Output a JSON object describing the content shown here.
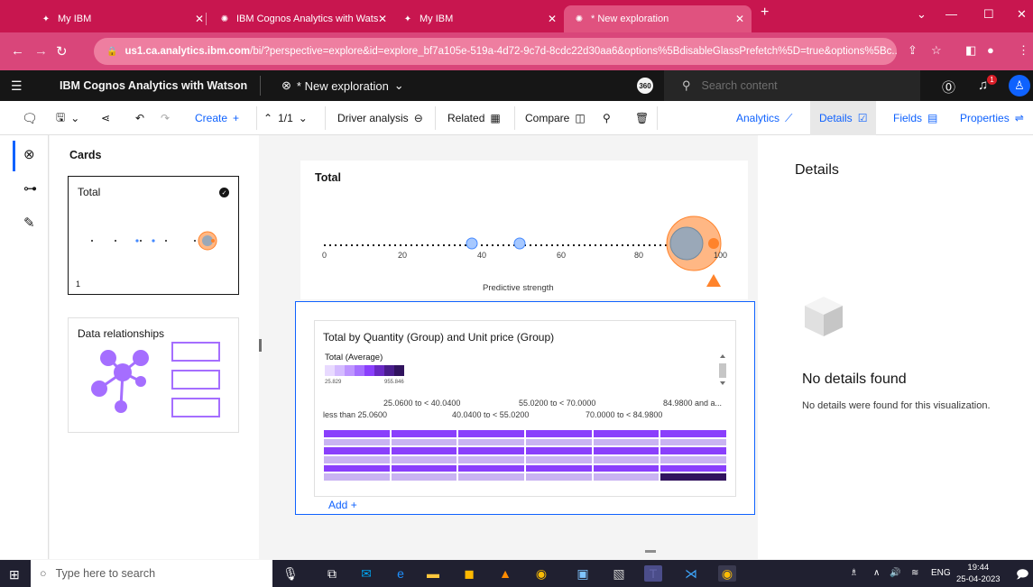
{
  "browser": {
    "tabs": [
      {
        "label": "My IBM",
        "active": false
      },
      {
        "label": "IBM Cognos Analytics with Wats",
        "active": false
      },
      {
        "label": "My IBM",
        "active": false
      },
      {
        "label": "* New exploration",
        "active": true
      }
    ],
    "new_tab": "+",
    "url_host": "us1.ca.analytics.ibm.com",
    "url_path": "/bi/?perspective=explore&id=explore_bf7a105e-519a-4d72-9c7d-8cdc22d30aa6&options%5BdisableGlassPrefetch%5D=true&options%5Bc..."
  },
  "app": {
    "product_name": "IBM Cognos Analytics with Watson",
    "exploration_title": "* New exploration",
    "badge": "360",
    "search_placeholder": "Search content",
    "notifications": "1"
  },
  "toolbar": {
    "create": "Create",
    "page_indicator": "1/1",
    "driver_analysis": "Driver analysis",
    "related": "Related",
    "compare": "Compare",
    "analytics": "Analytics",
    "details": "Details",
    "fields": "Fields",
    "properties": "Properties"
  },
  "cards_panel": {
    "title": "Cards",
    "card_total_label": "Total",
    "card_total_number": "1",
    "card_relationships_label": "Data relationships"
  },
  "total_card": {
    "title": "Total",
    "axis_label": "Predictive strength",
    "ticks": [
      "0",
      "20",
      "40",
      "60",
      "80",
      "100"
    ]
  },
  "viz": {
    "title": "Total by Quantity (Group) and Unit price (Group)",
    "legend_title": "Total (Average)",
    "legend_min": "25.829",
    "legend_max": "955.846",
    "categories_row1": [
      "25.0600 to < 40.0400",
      "55.0200 to < 70.0000",
      "84.9800 and a..."
    ],
    "categories_row2": [
      "less than 25.0600",
      "40.0400 to < 55.0200",
      "70.0000 to < 84.9800"
    ],
    "add_label": "Add",
    "colors": {
      "light": "#c9b3f2",
      "mid": "#8a3ffc",
      "dark": "#31135e"
    }
  },
  "details_panel": {
    "title": "Details",
    "empty_heading": "No details found",
    "empty_text": "No details were found for this visualization."
  },
  "taskbar": {
    "search_placeholder": "Type here to search",
    "language": "ENG",
    "time": "19:44",
    "date": "25-04-2023"
  }
}
